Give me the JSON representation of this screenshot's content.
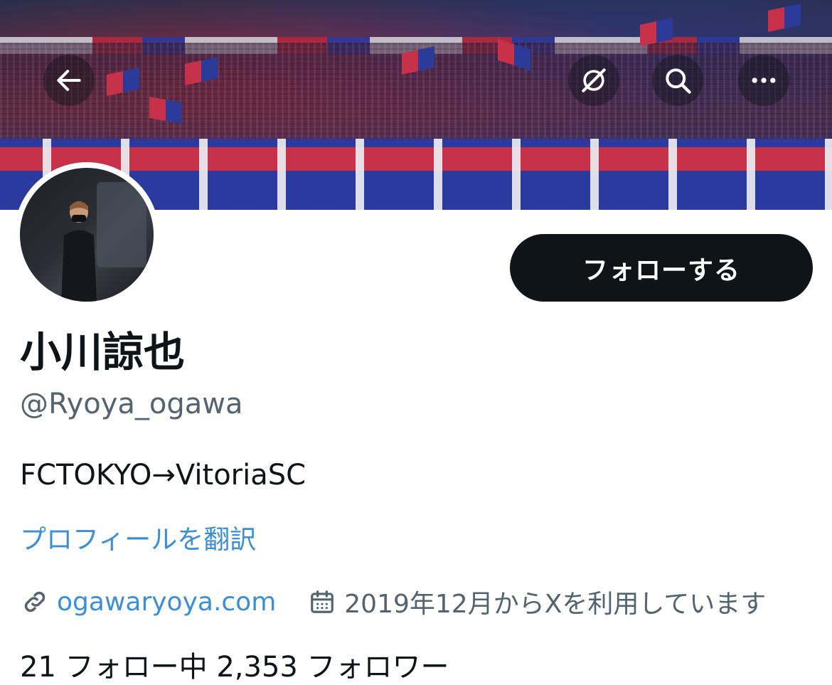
{
  "header": {
    "back_icon": "arrow-left-icon",
    "actions": [
      "notifications-off-icon",
      "search-icon",
      "more-icon"
    ]
  },
  "banner": {
    "description_colors": {
      "red": "#c8314a",
      "blue": "#2c3a9a"
    }
  },
  "profile": {
    "display_name": "小川諒也",
    "handle": "@Ryoya_ogawa",
    "bio": "FCTOKYO→VitoriaSC",
    "translate_label": "プロフィールを翻訳",
    "website": "ogawaryoya.com",
    "joined": "2019年12月からXを利用しています",
    "follow_label": "フォローする",
    "stats_partial": "21 フォロー中  2,353 フォロワー"
  },
  "colors": {
    "accent_link": "#3b8fd6",
    "text_primary": "#0f1419",
    "text_secondary": "#536471",
    "button_bg": "#0f1419"
  }
}
